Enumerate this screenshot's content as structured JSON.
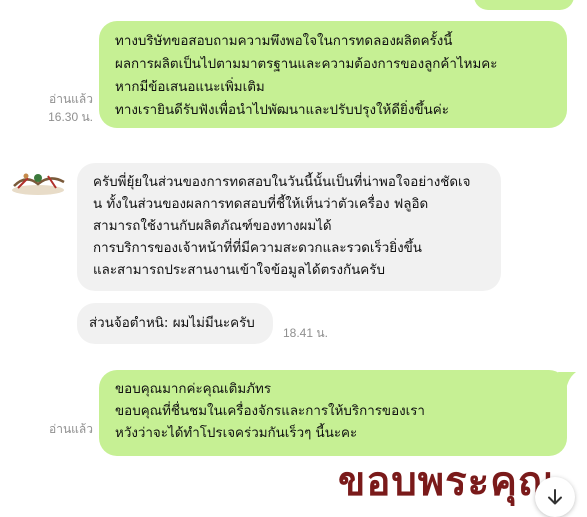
{
  "messages": [
    {
      "side": "sent",
      "read_label": "อ่านแล้ว",
      "time": "16.30 น.",
      "lines": [
        "ทางบริษัทขอสอบถามความพึงพอใจในการทดลองผลิตครั้งนี้",
        "ผลการผลิตเป็นไปตามมาตรฐานและความต้องการของลูกค้าไหมคะ",
        "หากมีข้อเสนอแนะเพิ่มเติม",
        "ทางเรายินดีรับฟังเพื่อนำไปพัฒนาและปรับปรุงให้ดียิ่งขึ้นค่ะ"
      ]
    },
    {
      "side": "received",
      "lines": [
        "ครับพี่ยุ้ยในส่วนของการทดสอบในวันนี้นั้นเป็นที่น่าพอใจอย่างชัดเจ",
        "น ทั้งในส่วนของผลการทดสอบที่ชี้ให้เห็นว่าตัวเครื่อง  ฟลูอิด",
        "สามารถใช้งานกับผลิตภัณฑ์ของทางผมได้",
        "การบริการของเจ้าหน้าที่ที่มีความสะดวกและรวดเร็วยิ่งขึ้น",
        "และสามารถประสานงานเข้าใจข้อมูลได้ตรงกันครับ"
      ]
    },
    {
      "side": "received",
      "time": "18.41 น.",
      "lines": [
        "ส่วนจ้อตำหนิ: ผมไม่มีนะครับ"
      ]
    },
    {
      "side": "sent",
      "read_label": "อ่านแล้ว",
      "lines": [
        "ขอบคุณมากค่ะคุณเติมภัทร",
        "ขอบคุณที่ชื่นชมในเครื่องจักรและการให้บริการของเรา",
        "หวังว่าจะได้ทำโปรเจคร่วมกันเร็วๆ นี้นะคะ"
      ]
    }
  ],
  "sticker": {
    "text": "ขอบพระคุณ",
    "color": "#7a1a1a"
  },
  "colors": {
    "sent_bubble": "#c6f094",
    "received_bubble": "#f1f1f1",
    "meta_text": "#8f8f8f"
  },
  "icons": {
    "scroll_down": "arrow-down-icon",
    "avatar": "avatar-image"
  }
}
